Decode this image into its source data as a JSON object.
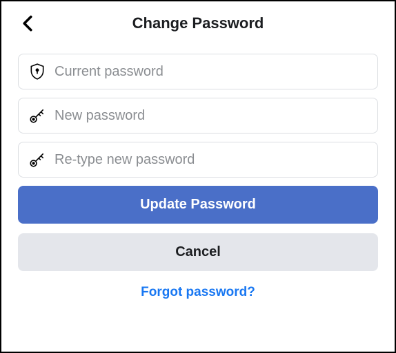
{
  "header": {
    "title": "Change Password"
  },
  "fields": {
    "current": {
      "placeholder": "Current password"
    },
    "new": {
      "placeholder": "New password"
    },
    "retype": {
      "placeholder": "Re-type new password"
    }
  },
  "buttons": {
    "update": "Update Password",
    "cancel": "Cancel",
    "forgot": "Forgot password?"
  }
}
